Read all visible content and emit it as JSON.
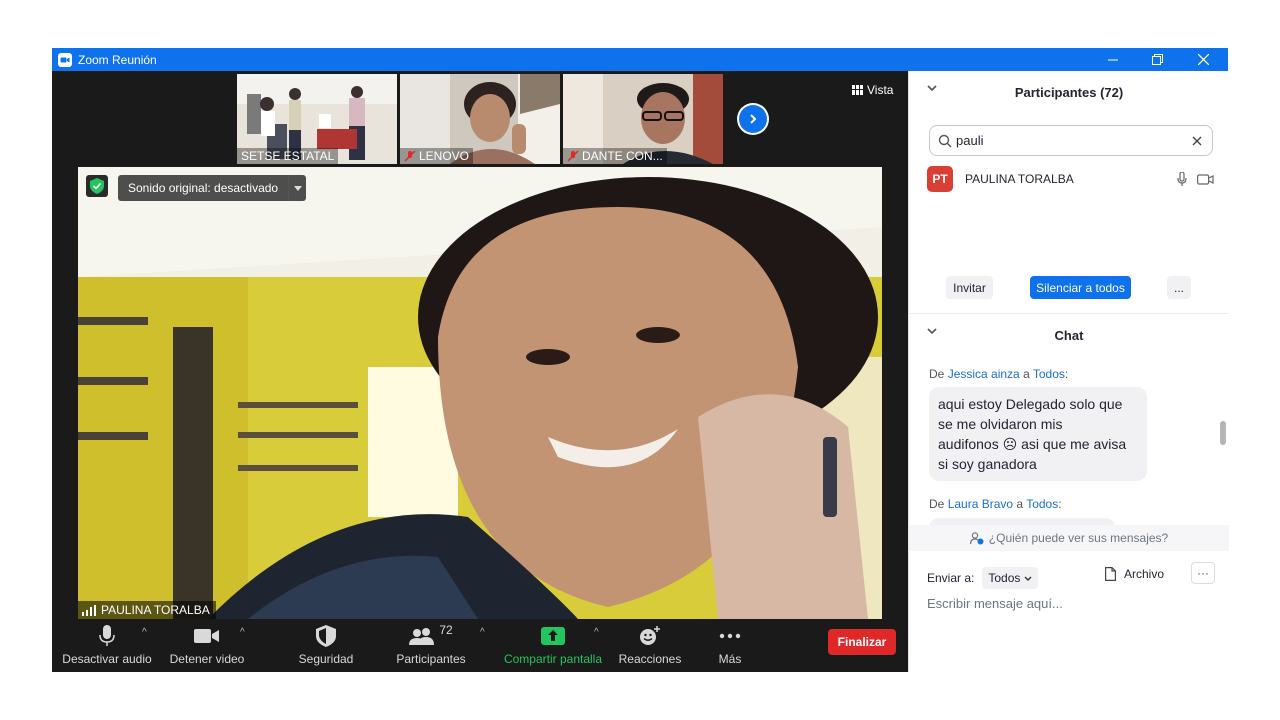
{
  "window": {
    "title": "Zoom Reunión"
  },
  "thumbnails": [
    {
      "name": "SETSE ESTATAL",
      "muted": false
    },
    {
      "name": "LENOVO",
      "muted": true
    },
    {
      "name": "DANTE CON...",
      "muted": true
    }
  ],
  "view_button": {
    "label": "Vista"
  },
  "main_video": {
    "sound_label": "Sonido original: desactivado",
    "speaker_name": "PAULINA TORALBA"
  },
  "toolbar": {
    "audio_label": "Desactivar audio",
    "video_label": "Detener video",
    "security_label": "Seguridad",
    "participants_label": "Participantes",
    "participants_count": "72",
    "share_label": "Compartir pantalla",
    "reactions_label": "Reacciones",
    "more_label": "Más",
    "end_label": "Finalizar"
  },
  "participants_panel": {
    "title": "Participantes (72)",
    "search_value": "pauli",
    "participant": {
      "initials": "PT",
      "name": "PAULINA TORALBA"
    },
    "invite_label": "Invitar",
    "mute_all_label": "Silenciar a todos",
    "more_label": "..."
  },
  "chat_panel": {
    "title": "Chat",
    "messages": [
      {
        "prefix": "De ",
        "sender": "Jessica ainza",
        "mid": " a ",
        "recipient": "Todos",
        "suffix": ":",
        "lines": [
          "aqui estoy Delegado solo que",
          "se me olvidaron mis",
          "audifonos ☹ asi que me avisa",
          "si soy ganadora"
        ]
      },
      {
        "prefix": "De ",
        "sender": "Laura Bravo",
        "mid": " a ",
        "recipient": "Todos",
        "suffix": ":"
      }
    ],
    "who_can_see": "¿Quién puede ver sus mensajes?",
    "send_to_label": "Enviar a:",
    "send_to_value": "Todos",
    "file_label": "Archivo",
    "more_label": "···",
    "input_placeholder": "Escribir mensaje aquí..."
  },
  "colors": {
    "accent": "#0e72ed",
    "end_red": "#e02828",
    "share_green": "#22c55e",
    "link_blue": "#1a6fd6"
  }
}
